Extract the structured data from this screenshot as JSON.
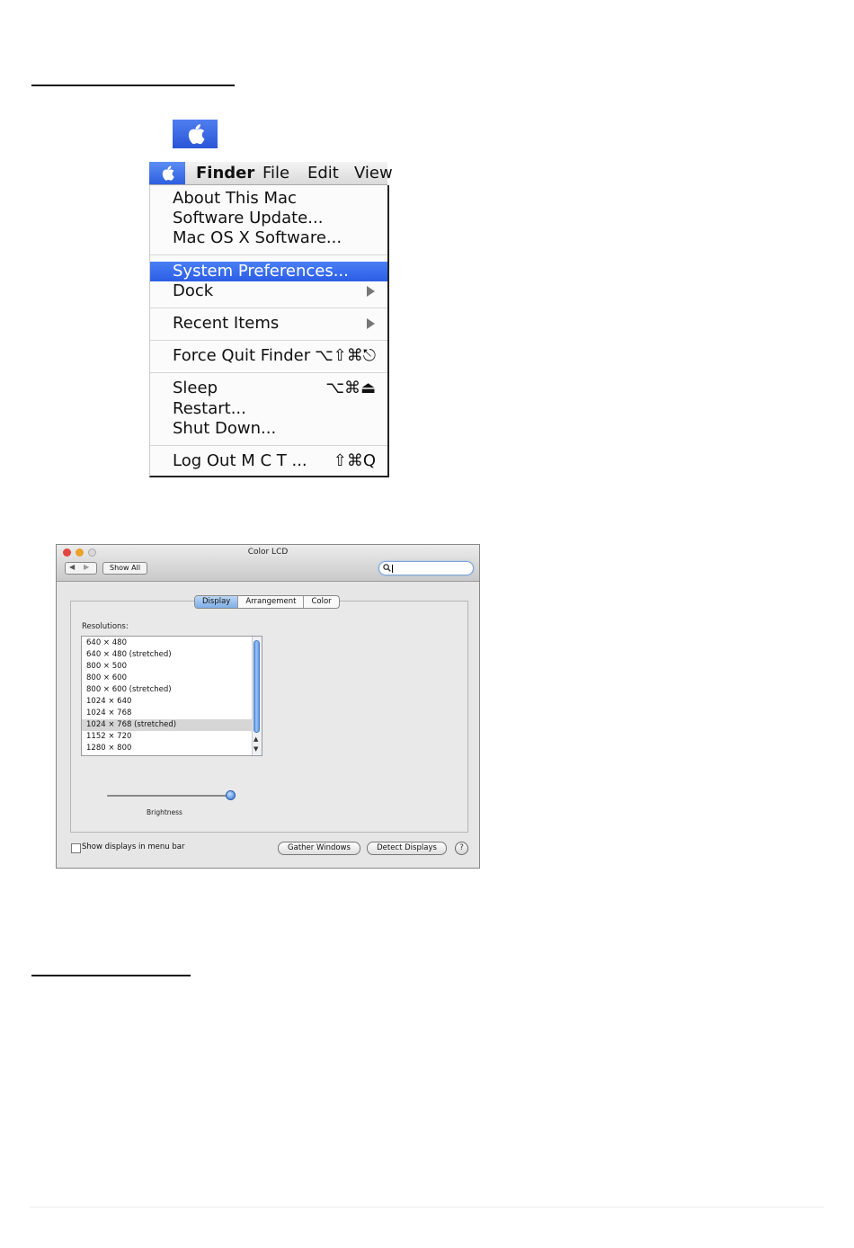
{
  "apple_menu": {
    "menubar": [
      "Finder",
      "File",
      "Edit",
      "View"
    ],
    "items": [
      {
        "label": "About This Mac",
        "shortcut": ""
      },
      {
        "label": "Software Update...",
        "shortcut": ""
      },
      {
        "label": "Mac OS X Software...",
        "shortcut": ""
      },
      {
        "label": "System Preferences...",
        "shortcut": "",
        "highlighted": true
      },
      {
        "label": "Dock",
        "shortcut": "",
        "submenu": true
      },
      {
        "label": "Recent Items",
        "shortcut": "",
        "submenu": true
      },
      {
        "label": "Force Quit Finder",
        "shortcut": "⌥⇧⌘⎋"
      },
      {
        "label": "Sleep",
        "shortcut": "⌥⌘⏏"
      },
      {
        "label": "Restart...",
        "shortcut": ""
      },
      {
        "label": "Shut Down...",
        "shortcut": ""
      },
      {
        "label": "Log Out M C T ...",
        "shortcut": "⇧⌘Q"
      }
    ]
  },
  "prefs_window": {
    "title": "Color LCD",
    "show_all": "Show All",
    "search_placeholder": "",
    "tabs": [
      "Display",
      "Arrangement",
      "Color"
    ],
    "active_tab": "Display",
    "resolutions_label": "Resolutions:",
    "resolutions": [
      "640 × 480",
      "640 × 480 (stretched)",
      "800 × 500",
      "800 × 600",
      "800 × 600 (stretched)",
      "1024 × 640",
      "1024 × 768",
      "1024 × 768 (stretched)",
      "1152 × 720",
      "1280 × 800"
    ],
    "selected_resolution": "1024 × 768 (stretched)",
    "brightness_label": "Brightness",
    "brightness_level": 0.97,
    "show_displays_label": "Show displays in menu bar",
    "show_displays_checked": false,
    "gather_windows": "Gather Windows",
    "detect_displays": "Detect Displays",
    "help": "?"
  },
  "colors": {
    "highlight": "#2b5de6",
    "apple_blue": "#3b66e4"
  }
}
